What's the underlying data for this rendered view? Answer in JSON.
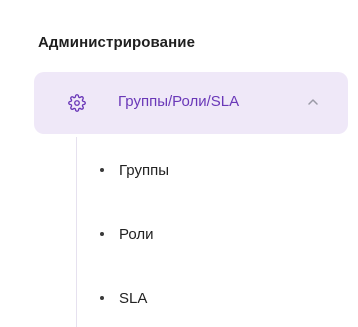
{
  "section": {
    "title": "Администрирование"
  },
  "group": {
    "label": "Группы/Роли/SLA",
    "icon": "gear-icon",
    "chevron_icon": "chevron-up-icon",
    "expanded": true,
    "accent_color": "#6a38b8",
    "background_color": "#efe8f8"
  },
  "items": [
    {
      "label": "Группы"
    },
    {
      "label": "Роли"
    },
    {
      "label": "SLA"
    }
  ]
}
